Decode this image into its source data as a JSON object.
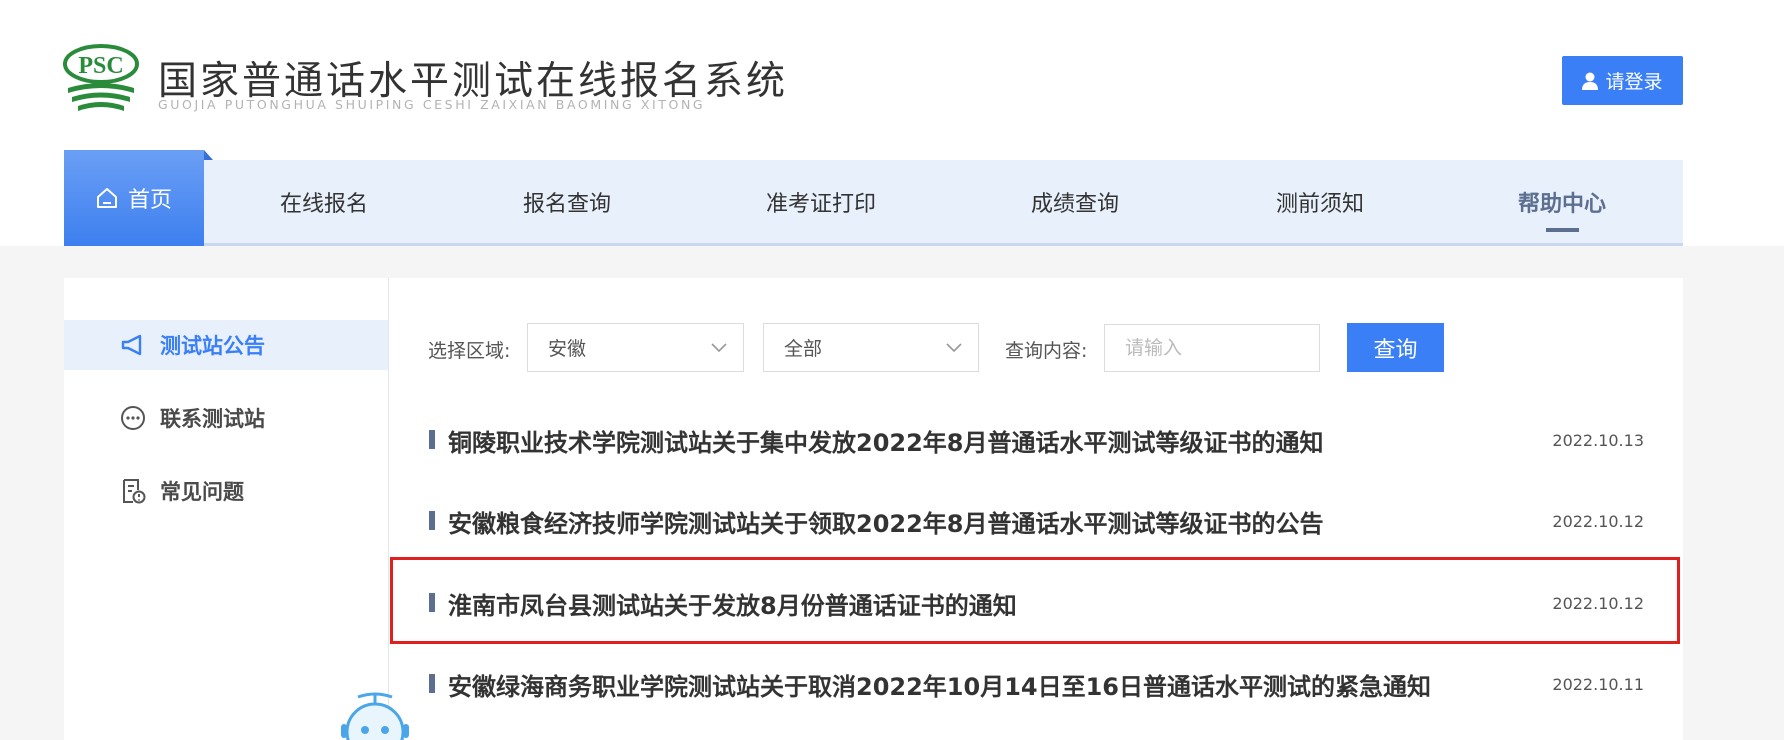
{
  "header": {
    "logo_text": "PSC",
    "title": "国家普通话水平测试在线报名系统",
    "subtitle": "GUOJIA PUTONGHUA SHUIPING CESHI ZAIXIAN BAOMING XITONG",
    "login_label": "请登录"
  },
  "nav": {
    "home": "首页",
    "items": [
      "在线报名",
      "报名查询",
      "准考证打印",
      "成绩查询",
      "测前须知",
      "帮助中心"
    ],
    "active_item": "帮助中心"
  },
  "sidebar": {
    "items": [
      {
        "label": "测试站公告",
        "icon": "megaphone-icon",
        "active": true
      },
      {
        "label": "联系测试站",
        "icon": "chat-bubble-icon",
        "active": false
      },
      {
        "label": "常见问题",
        "icon": "document-question-icon",
        "active": false
      }
    ]
  },
  "filter": {
    "region_label": "选择区域:",
    "region_value": "安徽",
    "sub_value": "全部",
    "query_label": "查询内容:",
    "query_placeholder": "请输入",
    "query_button": "查询"
  },
  "news": [
    {
      "title": "铜陵职业技术学院测试站关于集中发放2022年8月普通话水平测试等级证书的通知",
      "date": "2022.10.13"
    },
    {
      "title": "安徽粮食经济技师学院测试站关于领取2022年8月普通话水平测试等级证书的公告",
      "date": "2022.10.12"
    },
    {
      "title": "淮南市凤台县测试站关于发放8月份普通话证书的通知",
      "date": "2022.10.12",
      "highlighted": true
    },
    {
      "title": "安徽绿海商务职业学院测试站关于取消2022年10月14日至16日普通话水平测试的紧急通知",
      "date": "2022.10.11"
    }
  ],
  "colors": {
    "accent": "#3a7ff5",
    "nav_bg": "#e8f0fb",
    "active_nav": "#5c6f91",
    "logo_green": "#2a8c3a",
    "highlight": "#e0201c"
  }
}
